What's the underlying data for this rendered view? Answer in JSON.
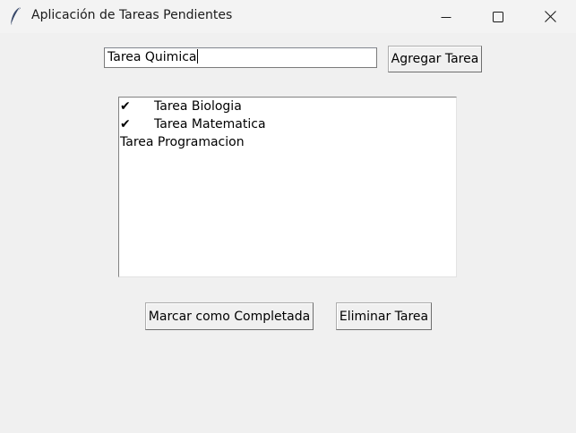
{
  "window": {
    "title": "Aplicación de Tareas Pendientes",
    "icon": "feather-icon"
  },
  "entry": {
    "value": "Tarea Quimica"
  },
  "buttons": {
    "add_label": "Agregar Tarea",
    "complete_label": "Marcar como Completada",
    "delete_label": "Eliminar Tarea"
  },
  "tasks": [
    {
      "mark": "✔",
      "label": "Tarea Biologia",
      "completed": true
    },
    {
      "mark": "✔",
      "label": "Tarea Matematica",
      "completed": true
    },
    {
      "mark": "",
      "label": "Tarea Programacion",
      "completed": false
    }
  ]
}
